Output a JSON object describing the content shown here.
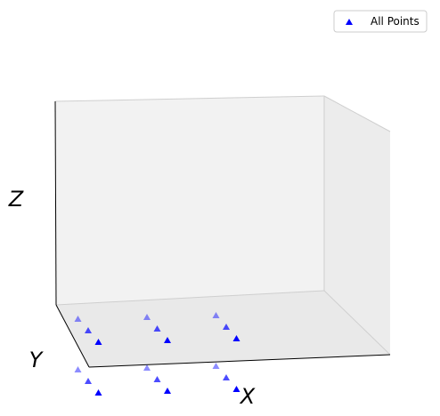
{
  "chart_data": {
    "type": "scatter",
    "projection": "3d",
    "xlabel": "X",
    "ylabel": "Y",
    "zlabel": "Z",
    "grid": false,
    "ticks_visible": false,
    "legend_position": "top-right",
    "series": [
      {
        "name": "All Points",
        "marker": "triangle-up",
        "color": "#0000ff",
        "points": [
          {
            "x": 1,
            "y": 1,
            "z": 1
          },
          {
            "x": 1,
            "y": 2,
            "z": 1
          },
          {
            "x": 1,
            "y": 3,
            "z": 1
          },
          {
            "x": 2,
            "y": 1,
            "z": 1
          },
          {
            "x": 2,
            "y": 2,
            "z": 1
          },
          {
            "x": 2,
            "y": 3,
            "z": 1
          },
          {
            "x": 3,
            "y": 1,
            "z": 1
          },
          {
            "x": 3,
            "y": 2,
            "z": 1
          },
          {
            "x": 3,
            "y": 3,
            "z": 1
          },
          {
            "x": 1,
            "y": 1,
            "z": 2
          },
          {
            "x": 1,
            "y": 2,
            "z": 2
          },
          {
            "x": 1,
            "y": 3,
            "z": 2
          },
          {
            "x": 2,
            "y": 1,
            "z": 2
          },
          {
            "x": 2,
            "y": 2,
            "z": 2
          },
          {
            "x": 2,
            "y": 3,
            "z": 2
          },
          {
            "x": 3,
            "y": 1,
            "z": 2
          },
          {
            "x": 3,
            "y": 2,
            "z": 2
          },
          {
            "x": 3,
            "y": 3,
            "z": 2
          }
        ]
      }
    ]
  }
}
